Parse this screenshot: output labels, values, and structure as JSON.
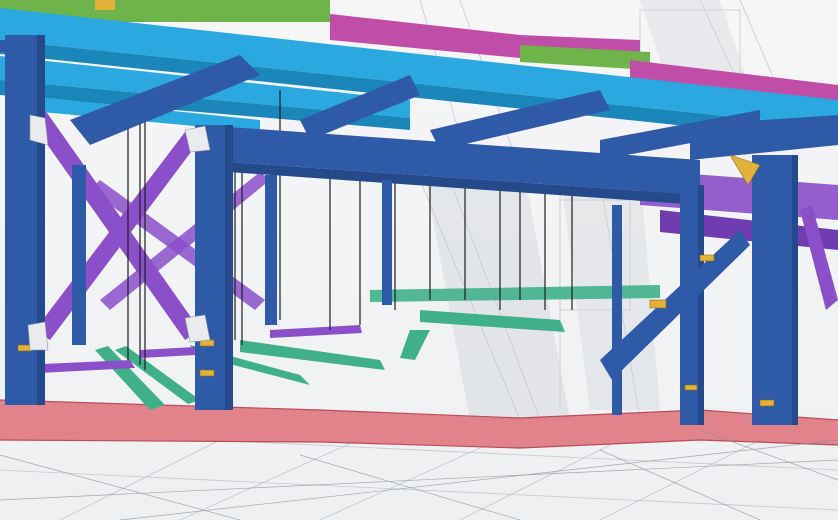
{
  "viewport": {
    "name": "3d-steel-model-viewport"
  },
  "colors": {
    "background": "#f3f4f6",
    "column_blue": "#2f5aa8",
    "column_blue_dark": "#244a8c",
    "beam_cyan": "#2aa8df",
    "beam_cyan_dark": "#1a86b9",
    "slab_green": "#6fb34b",
    "slab_magenta": "#c04ea8",
    "brace_purple": "#8a4fc9",
    "joist_green": "#3fb08a",
    "slab_pink": "#e0767f",
    "plate_yellow": "#e2b23a",
    "wire_gray": "#9aa0a8"
  }
}
